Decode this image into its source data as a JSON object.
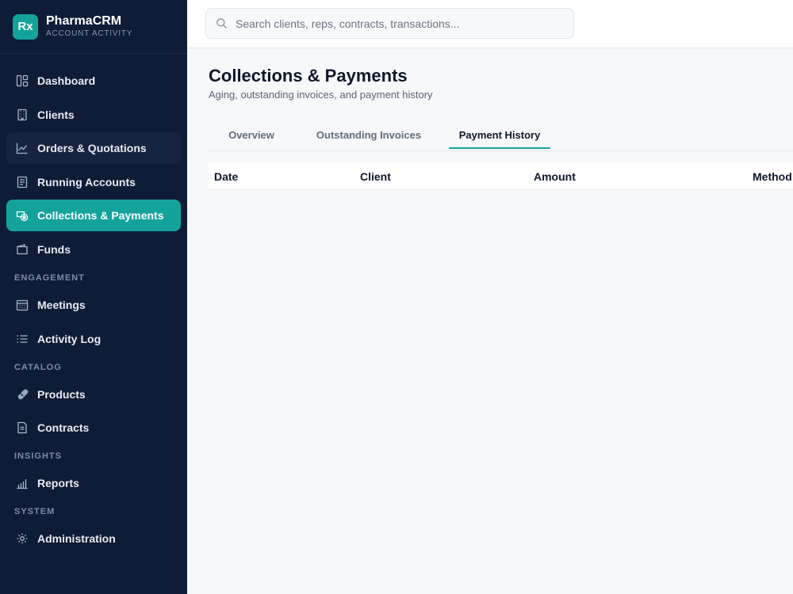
{
  "brand": {
    "logo": "Rx",
    "name": "PharmaCRM",
    "subtitle": "ACCOUNT ACTIVITY"
  },
  "search": {
    "placeholder": "Search clients, reps, contracts, transactions..."
  },
  "nav": {
    "main": [
      {
        "label": "Dashboard",
        "icon": "dashboard-icon"
      },
      {
        "label": "Clients",
        "icon": "building-icon"
      },
      {
        "label": "Orders & Quotations",
        "icon": "trending-chart-icon"
      },
      {
        "label": "Running Accounts",
        "icon": "ledger-icon"
      },
      {
        "label": "Collections & Payments",
        "icon": "money-transfer-icon"
      },
      {
        "label": "Funds",
        "icon": "wallet-icon"
      }
    ],
    "sections": [
      {
        "label": "ENGAGEMENT",
        "items": [
          {
            "label": "Meetings",
            "icon": "calendar-icon"
          },
          {
            "label": "Activity Log",
            "icon": "list-icon"
          }
        ]
      },
      {
        "label": "CATALOG",
        "items": [
          {
            "label": "Products",
            "icon": "pill-icon"
          },
          {
            "label": "Contracts",
            "icon": "document-icon"
          }
        ]
      },
      {
        "label": "INSIGHTS",
        "items": [
          {
            "label": "Reports",
            "icon": "bar-chart-icon"
          }
        ]
      },
      {
        "label": "SYSTEM",
        "items": [
          {
            "label": "Administration",
            "icon": "gear-icon"
          }
        ]
      }
    ],
    "active": "Collections & Payments"
  },
  "page": {
    "title": "Collections & Payments",
    "subtitle": "Aging, outstanding invoices, and payment history"
  },
  "tabs": [
    {
      "label": "Overview"
    },
    {
      "label": "Outstanding Invoices"
    },
    {
      "label": "Payment History"
    }
  ],
  "active_tab": "Payment History",
  "table": {
    "columns": [
      "Date",
      "Client",
      "Amount",
      "Method"
    ]
  },
  "colors": {
    "accent": "#14a39a",
    "sidebar": "#0f1c36"
  }
}
